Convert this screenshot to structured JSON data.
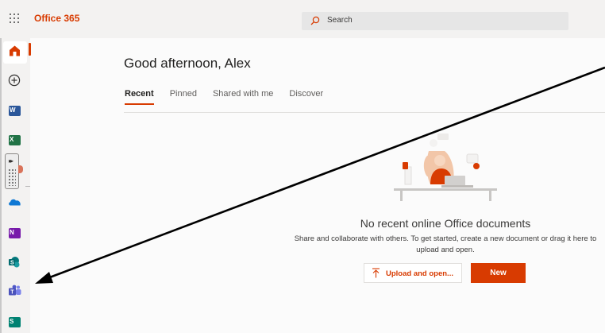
{
  "header": {
    "brand": "Office 365",
    "search_placeholder": "Search"
  },
  "sidebar": {
    "apps": [
      {
        "name": "home",
        "letter": ""
      },
      {
        "name": "create",
        "letter": ""
      },
      {
        "name": "word",
        "letter": "W",
        "color": "#2b579a"
      },
      {
        "name": "excel",
        "letter": "X",
        "color": "#217346"
      },
      {
        "name": "onedrive",
        "letter": "",
        "color": "#0f78d4"
      },
      {
        "name": "onenote",
        "letter": "N",
        "color": "#7719aa"
      },
      {
        "name": "sharepoint",
        "letter": "S",
        "color": "#03787c"
      },
      {
        "name": "teams",
        "letter": "T",
        "color": "#5558af"
      },
      {
        "name": "sway",
        "letter": "S",
        "color": "#008272"
      }
    ]
  },
  "main": {
    "greeting": "Good afternoon, Alex",
    "tabs": [
      {
        "label": "Recent",
        "active": true
      },
      {
        "label": "Pinned",
        "active": false
      },
      {
        "label": "Shared with me",
        "active": false
      },
      {
        "label": "Discover",
        "active": false
      }
    ],
    "empty": {
      "title": "No recent online Office documents",
      "description": "Share and collaborate with others. To get started, create a new document or drag it here to upload and open.",
      "upload_label": "Upload and open...",
      "new_label": "New"
    }
  },
  "colors": {
    "accent": "#d83b01",
    "rail": "#f3f2f1"
  }
}
